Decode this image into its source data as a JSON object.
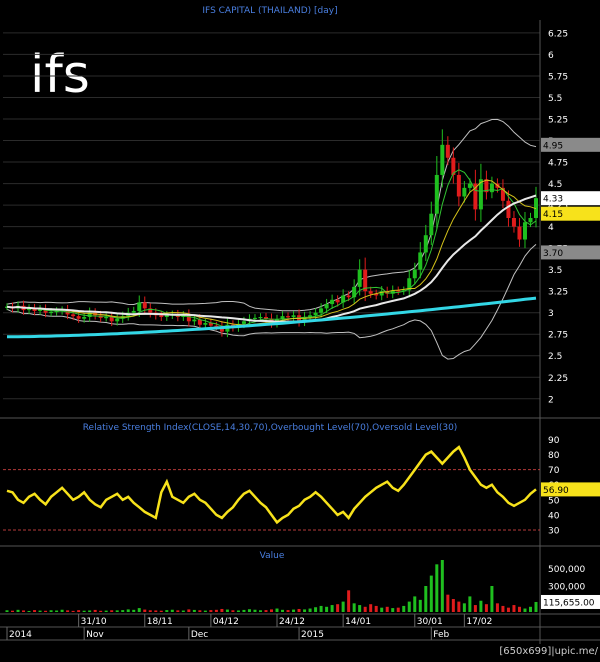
{
  "chart_data": [
    {
      "type": "candlestick",
      "title": "IFS CAPITAL (THAILAND) [day]",
      "symbol_label": "ifs",
      "y_ticks": [
        "6.25",
        "6",
        "5.75",
        "5.5",
        "5.25",
        "5",
        "4.75",
        "4.5",
        "4.25",
        "4",
        "3.75",
        "3.5",
        "3.25",
        "3",
        "2.75",
        "2.5",
        "2.25",
        "2"
      ],
      "ylim": [
        1.8,
        6.4
      ],
      "price_tags": [
        {
          "value": 4.95,
          "label": "4.95",
          "style": "gray"
        },
        {
          "value": 4.33,
          "label": "4.33",
          "style": "white"
        },
        {
          "value": 4.15,
          "label": "4.15",
          "style": "yellow"
        },
        {
          "value": 3.7,
          "label": "3.70",
          "style": "gray"
        }
      ],
      "series": [
        {
          "name": "close",
          "values": [
            3.07,
            3.05,
            3.08,
            3.03,
            3.05,
            3.02,
            3.04,
            3.0,
            3.01,
            3.02,
            3.03,
            2.98,
            2.96,
            2.93,
            2.95,
            3.0,
            2.97,
            2.94,
            2.95,
            2.9,
            2.93,
            2.96,
            3.0,
            3.02,
            3.12,
            3.05,
            3.0,
            2.97,
            2.95,
            2.97,
            2.98,
            2.95,
            2.97,
            2.9,
            2.92,
            2.86,
            2.88,
            2.85,
            2.84,
            2.78,
            2.86,
            2.83,
            2.87,
            2.9,
            2.93,
            2.94,
            2.95,
            2.93,
            2.88,
            2.92,
            2.96,
            2.95,
            2.97,
            2.9,
            2.95,
            2.97,
            3.0,
            3.05,
            3.1,
            3.15,
            3.12,
            3.2,
            3.18,
            3.3,
            3.5,
            3.25,
            3.22,
            3.2,
            3.25,
            3.22,
            3.26,
            3.25,
            3.26,
            3.4,
            3.5,
            3.7,
            3.9,
            4.15,
            4.6,
            4.95,
            4.8,
            4.6,
            4.35,
            4.45,
            4.5,
            4.2,
            4.55,
            4.4,
            4.5,
            4.45,
            4.3,
            4.1,
            4.0,
            3.85,
            4.05,
            4.1,
            4.33
          ]
        }
      ]
    },
    {
      "type": "line",
      "title": "Relative Strength Index(CLOSE,14,30,70),Overbought Level(70),Oversold Level(30)",
      "y_ticks": [
        "90",
        "80",
        "70",
        "60",
        "50",
        "40",
        "30"
      ],
      "ylim": [
        22,
        95
      ],
      "overbought": 70,
      "oversold": 30,
      "last_value_label": "56.90",
      "series": [
        {
          "name": "RSI",
          "values": [
            56,
            55,
            50,
            48,
            52,
            54,
            50,
            47,
            52,
            55,
            58,
            54,
            50,
            52,
            55,
            50,
            47,
            45,
            50,
            52,
            54,
            50,
            52,
            48,
            45,
            42,
            40,
            38,
            55,
            62,
            52,
            50,
            48,
            52,
            54,
            50,
            48,
            44,
            40,
            38,
            42,
            45,
            50,
            54,
            56,
            52,
            48,
            45,
            40,
            35,
            38,
            40,
            44,
            46,
            50,
            52,
            55,
            52,
            48,
            44,
            40,
            42,
            38,
            44,
            48,
            52,
            55,
            58,
            60,
            62,
            58,
            56,
            60,
            65,
            70,
            75,
            80,
            82,
            78,
            74,
            78,
            82,
            85,
            78,
            70,
            65,
            60,
            58,
            60,
            55,
            52,
            48,
            46,
            48,
            50,
            54,
            56.9
          ]
        }
      ]
    },
    {
      "type": "bar",
      "title": "Value",
      "y_ticks": [
        "500,000",
        "300,000"
      ],
      "ylim": [
        0,
        600000
      ],
      "last_value_label": "115,655.00",
      "values": [
        20000,
        15000,
        25000,
        18000,
        12000,
        22000,
        16000,
        14000,
        20000,
        17000,
        26000,
        19000,
        13000,
        21000,
        15000,
        18000,
        24000,
        14000,
        16000,
        20000,
        19000,
        22000,
        30000,
        25000,
        45000,
        28000,
        20000,
        18000,
        15000,
        22000,
        26000,
        19000,
        17000,
        30000,
        24000,
        20000,
        16000,
        22000,
        25000,
        35000,
        28000,
        20000,
        18000,
        24000,
        32000,
        26000,
        20000,
        22000,
        30000,
        40000,
        25000,
        22000,
        28000,
        35000,
        30000,
        40000,
        55000,
        70000,
        60000,
        80000,
        90000,
        120000,
        250000,
        100000,
        80000,
        60000,
        90000,
        70000,
        50000,
        60000,
        45000,
        50000,
        70000,
        120000,
        180000,
        140000,
        300000,
        420000,
        550000,
        600000,
        200000,
        150000,
        120000,
        100000,
        180000,
        80000,
        130000,
        90000,
        300000,
        100000,
        70000,
        50000,
        80000,
        60000,
        40000,
        60000,
        115655
      ]
    }
  ],
  "x_axis": {
    "labels": [
      "2014",
      "31/10",
      "Nov",
      "18/11",
      "Dec",
      "04/12",
      "24/12",
      "2015",
      "14/01",
      "30/01",
      "Feb",
      "17/02"
    ]
  },
  "watermark": "[650x699]|upic.me/",
  "colors": {
    "background": "#000000",
    "grid": "#2b2b2b",
    "up": "#1fbf1f",
    "down": "#e01c1c",
    "bollinger": "#c0c0c0",
    "ma_short": "#e8e8e8",
    "ma_long": "#33d7e6",
    "rsi": "#f7e21b",
    "levels": "#b33a3a",
    "tag_gray": "#8a8a8a",
    "tag_white": "#ffffff",
    "tag_yellow": "#f7e21b",
    "title": "#4a7fe0"
  }
}
